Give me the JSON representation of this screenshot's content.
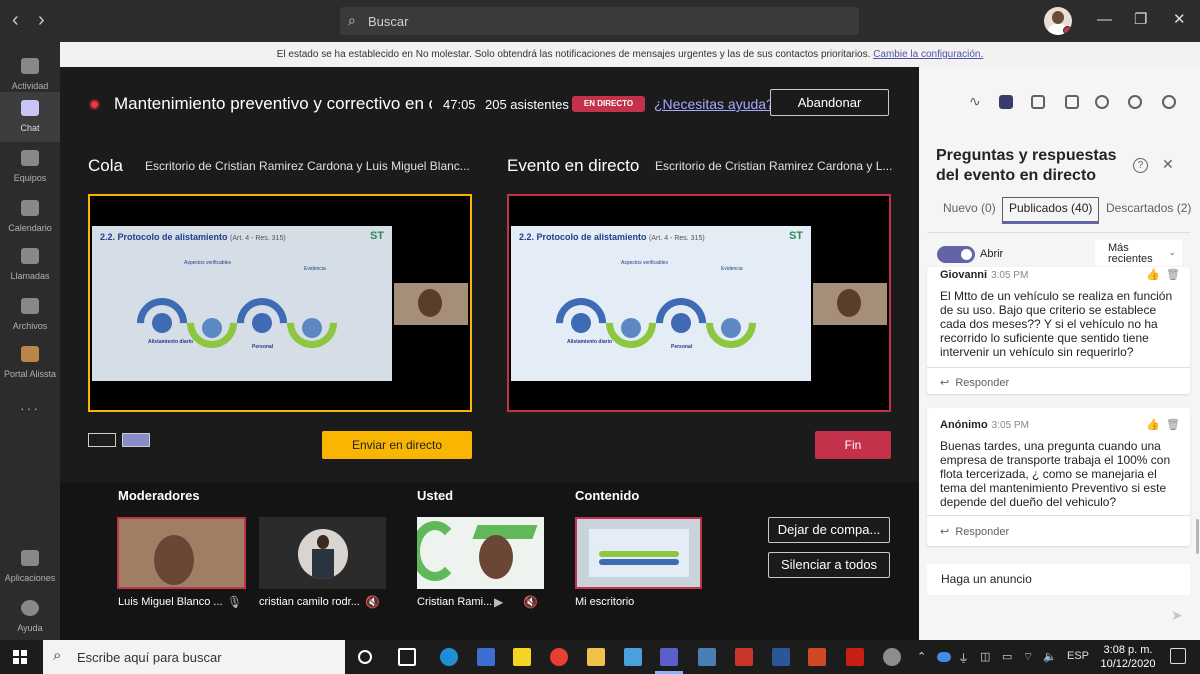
{
  "titlebar": {
    "search_placeholder": "Buscar",
    "nav_back": "‹",
    "nav_forward": "›",
    "win_minimize": "—",
    "win_maximize": "❐",
    "win_close": "✕"
  },
  "banner": {
    "text": "El estado se ha establecido en No molestar. Solo obtendrá las notificaciones de mensajes urgentes y las de sus contactos prioritarios.",
    "link": "Cambie la configuración."
  },
  "rail": [
    {
      "label": "Actividad"
    },
    {
      "label": "Chat"
    },
    {
      "label": "Equipos"
    },
    {
      "label": "Calendario"
    },
    {
      "label": "Llamadas"
    },
    {
      "label": "Archivos"
    },
    {
      "label": "Portal Alissta"
    },
    {
      "label": "Aplicaciones"
    },
    {
      "label": "Ayuda"
    }
  ],
  "event": {
    "title": "Mantenimiento preventivo y correctivo en c...",
    "elapsed": "47:05",
    "attendees": "205 asistentes",
    "live_badge": "EN DIRECTO",
    "help_link": "¿Necesitas ayuda?",
    "leave_button": "Abandonar"
  },
  "queue": {
    "label": "Cola",
    "subtitle": "Escritorio de Cristian Ramirez Cardona y Luis Miguel Blanc...",
    "send_button": "Enviar en directo"
  },
  "live": {
    "label": "Evento en directo",
    "subtitle": "Escritorio de Cristian Ramirez Cardona y L...",
    "end_button": "Fin"
  },
  "slide": {
    "title": "2.2. Protocolo de alistamiento",
    "ref": "(Art. 4 - Res. 315)",
    "logo": "ST",
    "col1": "Aspectos verificables",
    "col2": "Evidencia",
    "label1": "Alistamiento diario",
    "label2": "Personal"
  },
  "bottom": {
    "moderators_header": "Moderadores",
    "you_header": "Usted",
    "content_header": "Contenido",
    "tiles": [
      {
        "name": "Luis Miguel Blanco ..."
      },
      {
        "name": "cristian camilo rodr..."
      },
      {
        "name": "Cristian Rami..."
      },
      {
        "name": "Mi escritorio"
      }
    ],
    "stop_share_button": "Dejar de compa...",
    "mute_all_button": "Silenciar a todos"
  },
  "panel": {
    "title_line1": "Preguntas y respuestas",
    "title_line2": "del evento en directo",
    "tabs": [
      "Nuevo (0)",
      "Publicados (40)",
      "Descartados (2)"
    ],
    "toggle_label": "Abrir",
    "sort_label_1": "Más",
    "sort_label_2": "recientes",
    "questions": [
      {
        "author": "Giovanni",
        "time": "3:05 PM",
        "text": "El Mtto de un vehículo se realiza en función de su uso. Bajo que criterio se establece cada dos meses?? Y si el vehículo no ha recorrido lo suficiente que sentido tiene intervenir un vehículo sin requerirlo?",
        "reply": "Responder"
      },
      {
        "author": "Anónimo",
        "time": "3:05 PM",
        "text": "Buenas tardes, una pregunta cuando una empresa de transporte trabaja el 100% con flota tercerizada, ¿ como se manejaria el tema del mantenimiento Preventivo si este depende del dueño del vehiculo?",
        "reply": "Responder"
      }
    ],
    "announcement_placeholder": "Haga un anuncio"
  },
  "taskbar": {
    "search_placeholder": "Escribe aquí para buscar",
    "language": "ESP",
    "time": "3:08 p. m.",
    "date": "10/12/2020"
  },
  "colors": {
    "accent": "#6264a7",
    "live_red": "#c4314b",
    "queue_yellow": "#f8b602"
  }
}
